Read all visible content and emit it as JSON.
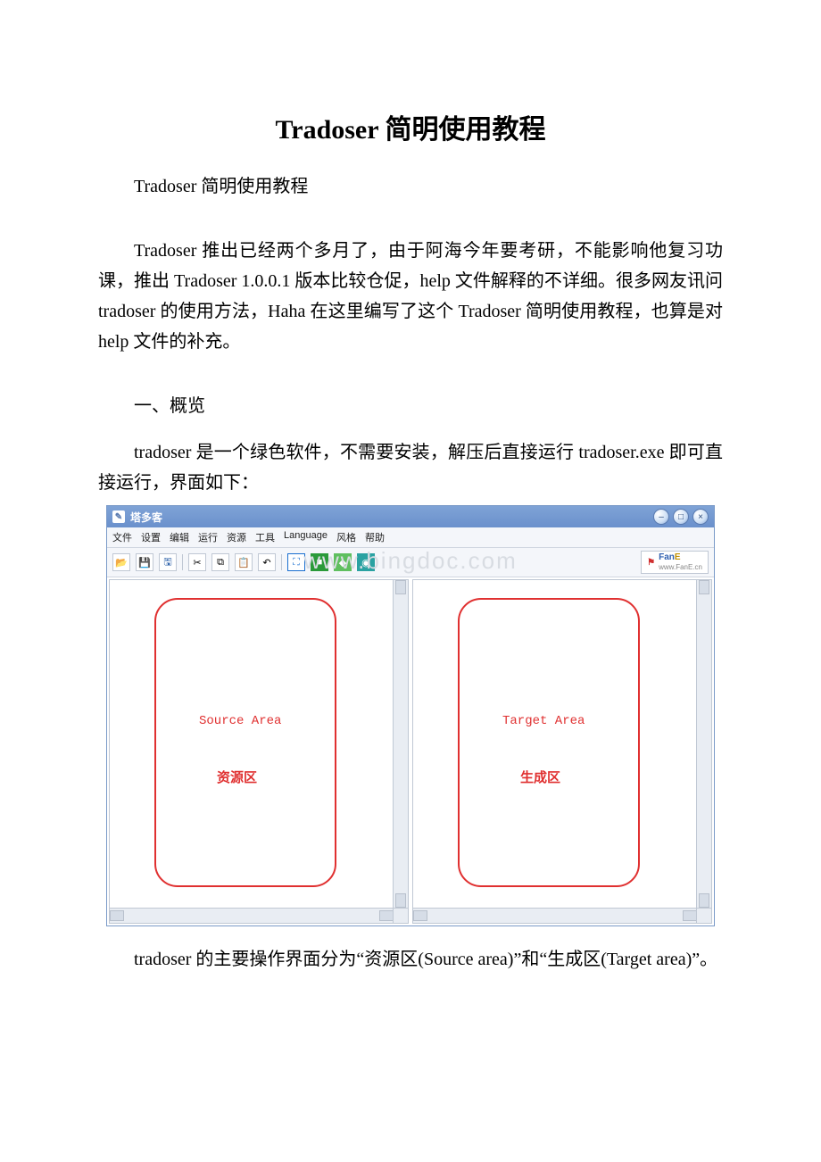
{
  "doc": {
    "title": "Tradoser 简明使用教程",
    "subtitle": "Tradoser 简明使用教程",
    "para1": "Tradoser 推出已经两个多月了，由于阿海今年要考研，不能影响他复习功课，推出 Tradoser 1.0.0.1 版本比较仓促，help 文件解释的不详细。很多网友讯问 tradoser 的使用方法，Haha 在这里编写了这个 Tradoser 简明使用教程，也算是对 help 文件的补充。",
    "section1": "一、概览",
    "para2": "tradoser 是一个绿色软件，不需要安装，解压后直接运行 tradoser.exe 即可直接运行，界面如下：",
    "para3": "tradoser 的主要操作界面分为“资源区(Source area)”和“生成区(Target area)”。"
  },
  "screenshot": {
    "titlebar_text": "塔多客",
    "titlebar_icon_glyph": "✎",
    "win_min_glyph": "–",
    "win_max_glyph": "□",
    "win_close_glyph": "×",
    "menu": {
      "file": "文件",
      "settings": "设置",
      "edit": "编辑",
      "run": "运行",
      "resource": "资源",
      "tools": "工具",
      "language": "Language",
      "style": "风格",
      "help": "帮助"
    },
    "logo": {
      "flag": "⚑",
      "fan": "Fan",
      "tail": "E",
      "url": "www.FanE.cn"
    },
    "source": {
      "en": "Source Area",
      "cn": "资源区"
    },
    "target": {
      "en": "Target Area",
      "cn": "生成区"
    },
    "watermark": "www.bingdoc.com"
  }
}
